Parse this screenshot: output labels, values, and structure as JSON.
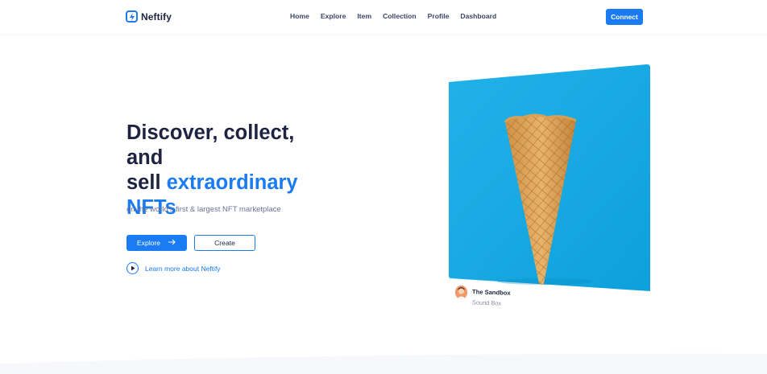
{
  "brand": {
    "name": "Neftify",
    "accent_color": "#1a7bf2",
    "logo_icon": "bolt-icon"
  },
  "nav": {
    "items": [
      {
        "label": "Home"
      },
      {
        "label": "Explore"
      },
      {
        "label": "Item"
      },
      {
        "label": "Collection"
      },
      {
        "label": "Profile"
      },
      {
        "label": "Dashboard"
      }
    ]
  },
  "header": {
    "connect_label": "Connect"
  },
  "hero": {
    "title_line1": "Discover, collect, and",
    "title_line2_prefix": "sell ",
    "title_accent": "extraordinary",
    "title_line3": "NFTs",
    "subtitle": "on the world's first & largest NFT marketplace",
    "explore_label": "Explore",
    "explore_icon": "arrow-right-icon",
    "create_label": "Create",
    "learn_more_label": "Learn more about Neftify",
    "learn_more_icon": "play-icon"
  },
  "featured": {
    "owner_name": "The Sandbox",
    "item_name": "Sound Box",
    "image_subject": "waffle cone on blue background",
    "background_color": "#14a8e2"
  }
}
